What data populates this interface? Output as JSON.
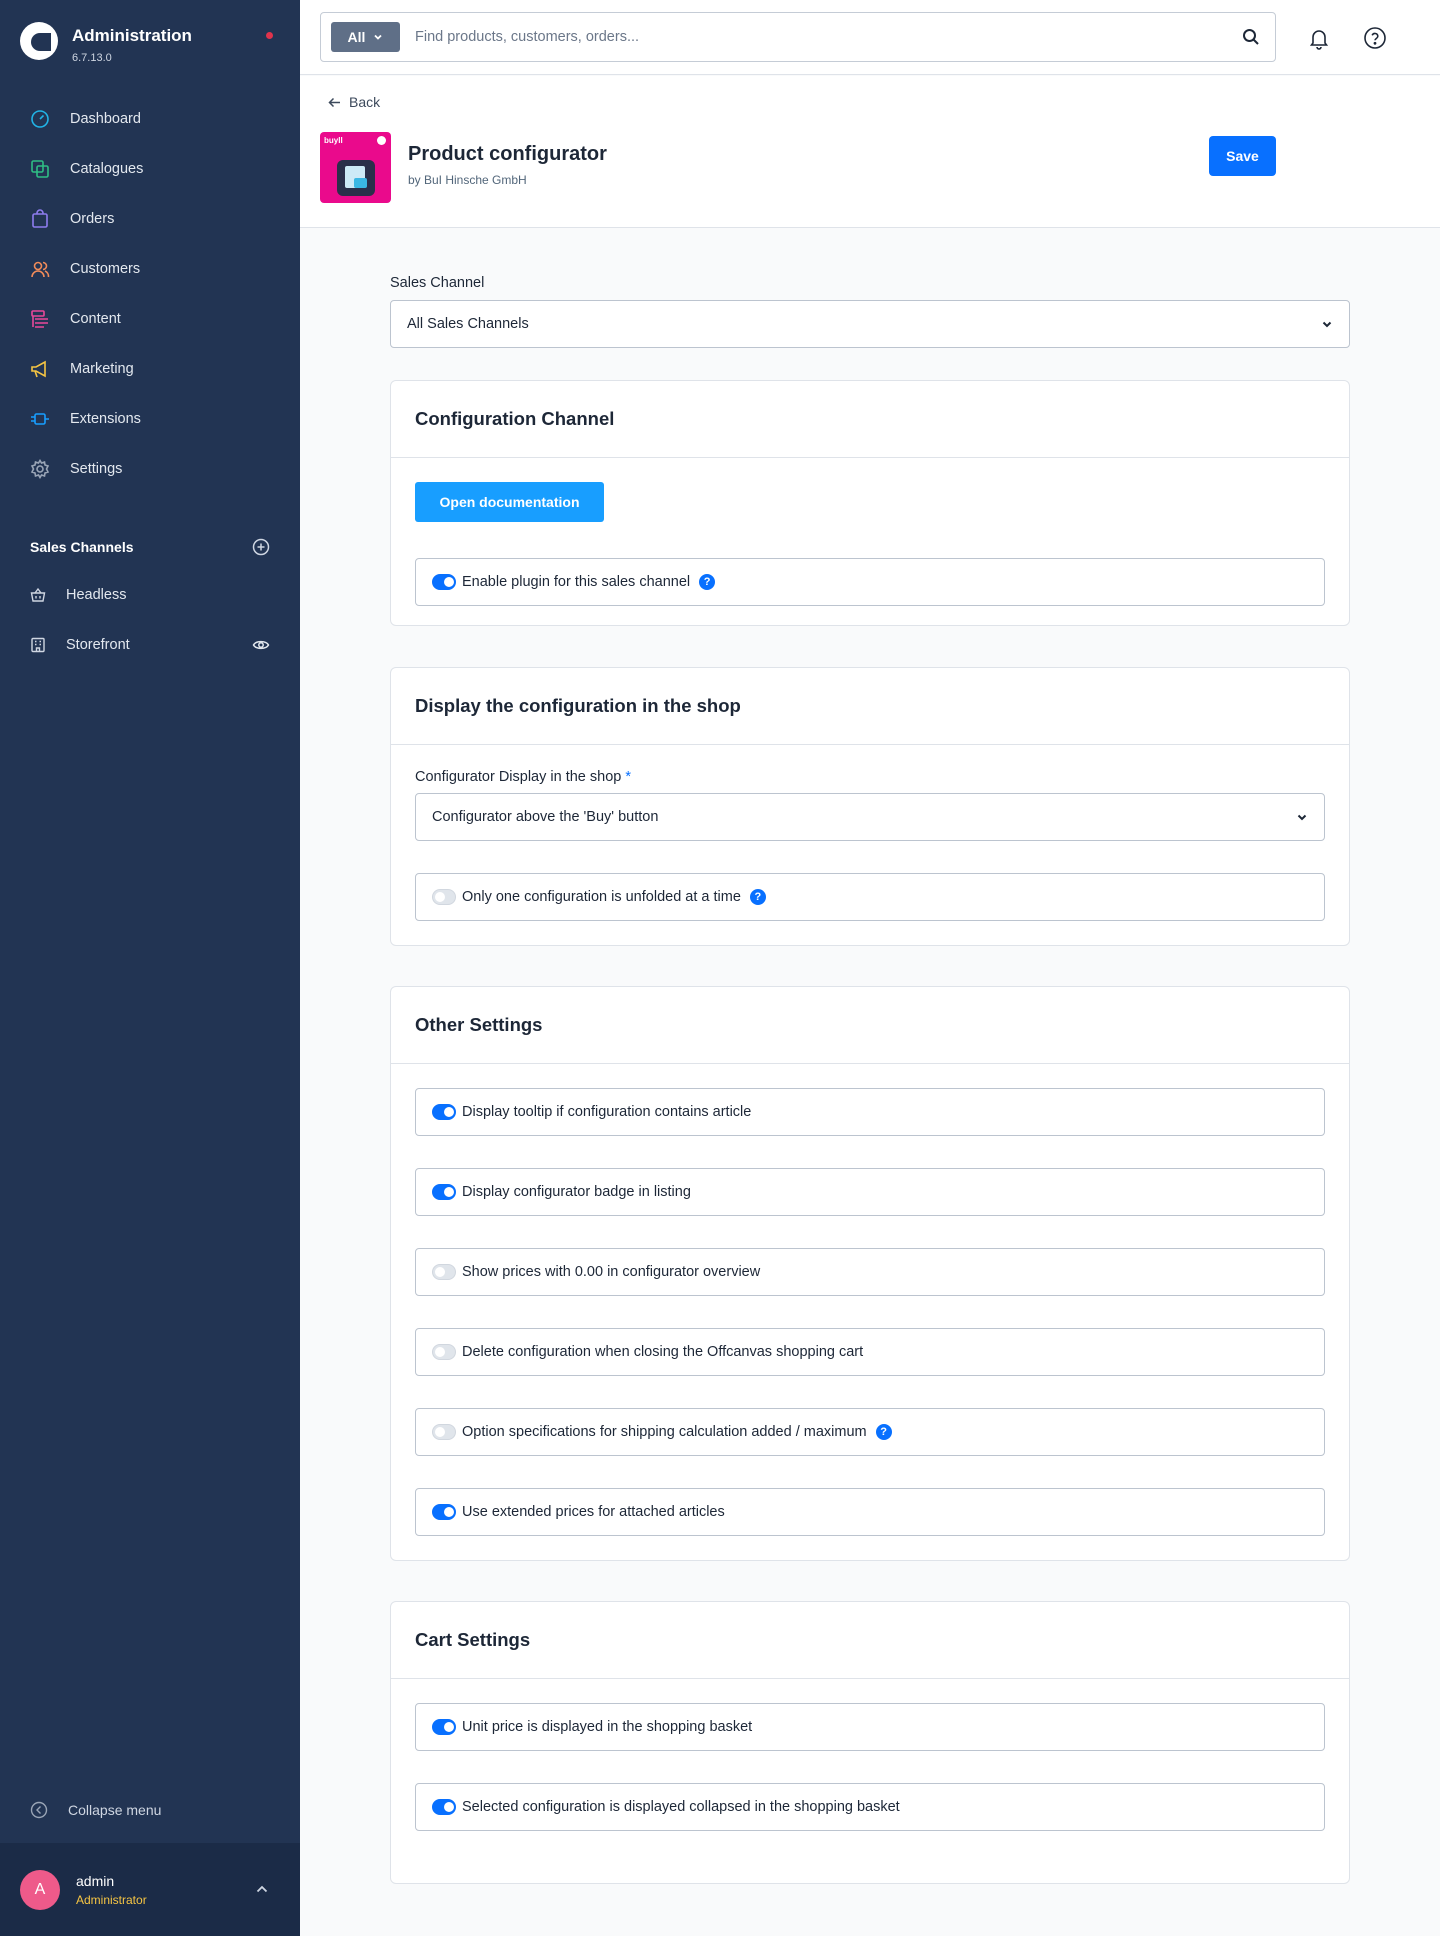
{
  "app": {
    "title": "Administration",
    "version": "6.7.13.0"
  },
  "nav": {
    "items": [
      {
        "label": "Dashboard",
        "icon": "dashboard-icon",
        "color": "#21b3e6"
      },
      {
        "label": "Catalogues",
        "icon": "catalogues-icon",
        "color": "#2fbf84"
      },
      {
        "label": "Orders",
        "icon": "orders-icon",
        "color": "#8e7cf0"
      },
      {
        "label": "Customers",
        "icon": "customers-icon",
        "color": "#f08b5a"
      },
      {
        "label": "Content",
        "icon": "content-icon",
        "color": "#e9489a"
      },
      {
        "label": "Marketing",
        "icon": "marketing-icon",
        "color": "#f6c543"
      },
      {
        "label": "Extensions",
        "icon": "extensions-icon",
        "color": "#189eff"
      },
      {
        "label": "Settings",
        "icon": "settings-icon",
        "color": "#9aa5b6"
      }
    ],
    "sales_channels_title": "Sales Channels",
    "channels": [
      {
        "label": "Headless",
        "icon": "basket-icon"
      },
      {
        "label": "Storefront",
        "icon": "storefront-icon"
      }
    ],
    "collapse_label": "Collapse menu"
  },
  "user": {
    "initial": "A",
    "name": "admin",
    "role": "Administrator"
  },
  "search": {
    "type_label": "All",
    "placeholder": "Find products, customers, orders..."
  },
  "header": {
    "back_label": "Back",
    "plugin_logo_tag": "buyll",
    "plugin_title": "Product configurator",
    "plugin_vendor": "by BuI Hinsche GmbH",
    "save_label": "Save"
  },
  "sales_channel": {
    "label": "Sales Channel",
    "value": "All Sales Channels"
  },
  "cards": {
    "configuration": {
      "title": "Configuration Channel",
      "doc_button": "Open documentation",
      "toggles": [
        {
          "label": "Enable plugin for this sales channel",
          "on": true,
          "help": true
        }
      ]
    },
    "display": {
      "title": "Display the configuration in the shop",
      "select_label": "Configurator Display in the shop",
      "required_mark": "*",
      "select_value": "Configurator above the 'Buy' button",
      "toggles": [
        {
          "label": "Only one configuration is unfolded at a time",
          "on": false,
          "help": true
        }
      ]
    },
    "other": {
      "title": "Other Settings",
      "toggles": [
        {
          "label": "Display tooltip if configuration contains article",
          "on": true,
          "help": false
        },
        {
          "label": "Display configurator badge in listing",
          "on": true,
          "help": false
        },
        {
          "label": "Show prices with 0.00 in configurator overview",
          "on": false,
          "help": false
        },
        {
          "label": "Delete configuration when closing the Offcanvas shopping cart",
          "on": false,
          "help": false
        },
        {
          "label": "Option specifications for shipping calculation added / maximum",
          "on": false,
          "help": true
        },
        {
          "label": "Use extended prices for attached articles",
          "on": true,
          "help": false
        }
      ]
    },
    "cart": {
      "title": "Cart Settings",
      "toggles": [
        {
          "label": "Unit price is displayed in the shopping basket",
          "on": true,
          "help": false
        },
        {
          "label": "Selected configuration is displayed collapsed in the shopping basket",
          "on": true,
          "help": false
        }
      ]
    }
  },
  "help_glyph": "?",
  "colors": {
    "sidebar": "#223453",
    "primary": "#0870ff",
    "doc_button": "#189eff",
    "notification_dot": "#e0334c",
    "plugin_logo": "#ea0a8c"
  }
}
